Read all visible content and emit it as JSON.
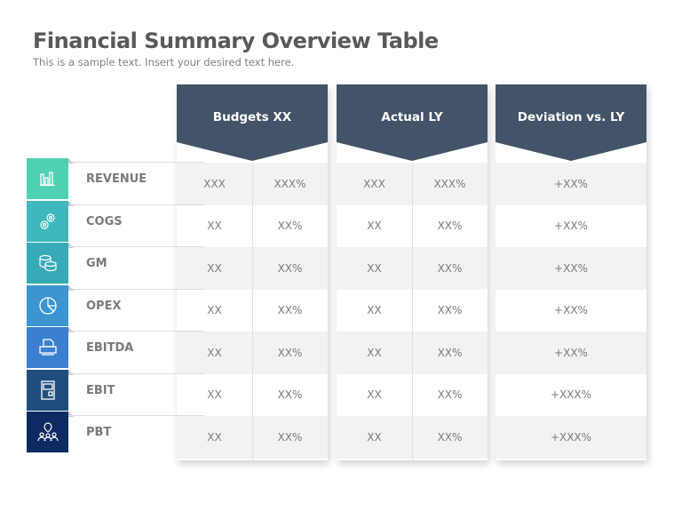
{
  "header": {
    "title": "Financial Summary Overview Table",
    "subtitle": "This is a sample text. Insert your desired text here."
  },
  "columns": [
    {
      "label": "Budgets XX"
    },
    {
      "label": "Actual LY"
    },
    {
      "label": "Deviation vs. LY"
    }
  ],
  "colors": {
    "header": "#435368",
    "stripe": "#f2f2f2",
    "text": "#7a7a7a"
  },
  "rows": [
    {
      "label": "REVENUE",
      "icon": "bar-chart-icon",
      "color": "#4fd1b3",
      "budget_value": "XXX",
      "budget_pct": "XXX%",
      "actual_value": "XXX",
      "actual_pct": "XXX%",
      "deviation": "+XX%"
    },
    {
      "label": "COGS",
      "icon": "gears-icon",
      "color": "#3fb8bb",
      "budget_value": "XX",
      "budget_pct": "XX%",
      "actual_value": "XX",
      "actual_pct": "XX%",
      "deviation": "+XX%"
    },
    {
      "label": "GM",
      "icon": "coins-icon",
      "color": "#37aab8",
      "budget_value": "XX",
      "budget_pct": "XX%",
      "actual_value": "XX",
      "actual_pct": "XX%",
      "deviation": "+XX%"
    },
    {
      "label": "OPEX",
      "icon": "pie-chart-icon",
      "color": "#3a95d2",
      "budget_value": "XX",
      "budget_pct": "XX%",
      "actual_value": "XX",
      "actual_pct": "XX%",
      "deviation": "+XX%"
    },
    {
      "label": "EBITDA",
      "icon": "printer-icon",
      "color": "#3a7fd0",
      "budget_value": "XX",
      "budget_pct": "XX%",
      "actual_value": "XX",
      "actual_pct": "XX%",
      "deviation": "+XX%"
    },
    {
      "label": "EBIT",
      "icon": "document-icon",
      "color": "#204e7c",
      "budget_value": "XX",
      "budget_pct": "XX%",
      "actual_value": "XX",
      "actual_pct": "XX%",
      "deviation": "+XXX%"
    },
    {
      "label": "PBT",
      "icon": "team-location-icon",
      "color": "#0e2a62",
      "budget_value": "XX",
      "budget_pct": "XX%",
      "actual_value": "XX",
      "actual_pct": "XX%",
      "deviation": "+XXX%"
    }
  ]
}
